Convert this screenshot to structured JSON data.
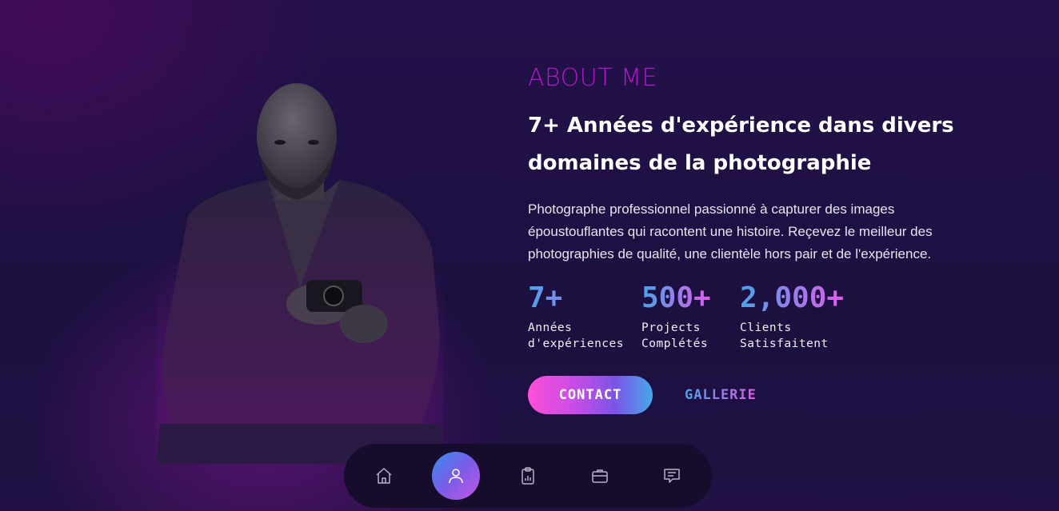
{
  "about": {
    "title": "ABOUT ME",
    "headline": "7+ Années d'expérience dans divers domaines de la photographie",
    "description": "Photographe professionnel passionné à capturer des images époustouflantes qui racontent une histoire. Reçevez le meilleur des photographies de qualité, une clientèle hors pair et de l'expérience."
  },
  "stats": [
    {
      "value": "7+",
      "label": "Années\nd'expériences"
    },
    {
      "value": "500+",
      "label": "Projects\nComplétés"
    },
    {
      "value": "2,000+",
      "label": "Clients\nSatisfaitent"
    }
  ],
  "buttons": {
    "contact": "CONTACT",
    "gallery": "GALLERIE"
  },
  "nav": [
    {
      "icon": "home-icon",
      "active": false
    },
    {
      "icon": "user-icon",
      "active": true
    },
    {
      "icon": "clipboard-chart-icon",
      "active": false
    },
    {
      "icon": "briefcase-icon",
      "active": false
    },
    {
      "icon": "message-icon",
      "active": false
    }
  ],
  "colors": {
    "accent_magenta": "#b117c9",
    "gradient_start": "#4aa3ea",
    "gradient_end": "#e15bea",
    "background": "#1c1040"
  }
}
